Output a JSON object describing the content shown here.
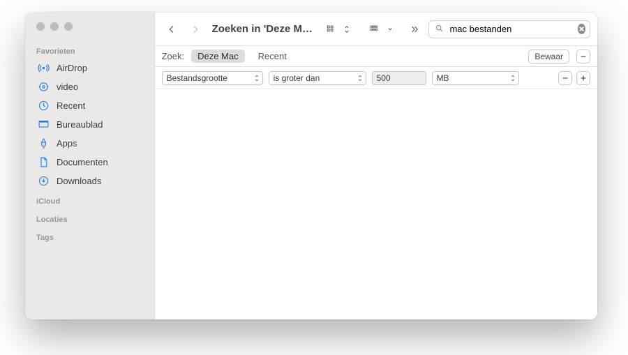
{
  "sidebar": {
    "sections": {
      "favorites": "Favorieten",
      "icloud": "iCloud",
      "locations": "Locaties",
      "tags": "Tags"
    },
    "items": [
      {
        "label": "AirDrop",
        "icon": "airdrop-icon"
      },
      {
        "label": "video",
        "icon": "video-icon"
      },
      {
        "label": "Recent",
        "icon": "clock-icon"
      },
      {
        "label": "Bureaublad",
        "icon": "desktop-icon"
      },
      {
        "label": "Apps",
        "icon": "apps-icon"
      },
      {
        "label": "Documenten",
        "icon": "document-icon"
      },
      {
        "label": "Downloads",
        "icon": "download-icon"
      }
    ]
  },
  "toolbar": {
    "title": "Zoeken in 'Deze M…"
  },
  "search": {
    "value": "mac bestanden"
  },
  "scope": {
    "label": "Zoek:",
    "options": [
      "Deze Mac",
      "Recent"
    ],
    "active_index": 0,
    "save_label": "Bewaar"
  },
  "criteria": {
    "attribute": "Bestandsgrootte",
    "operator": "is groter dan",
    "value": "500",
    "unit": "MB"
  }
}
